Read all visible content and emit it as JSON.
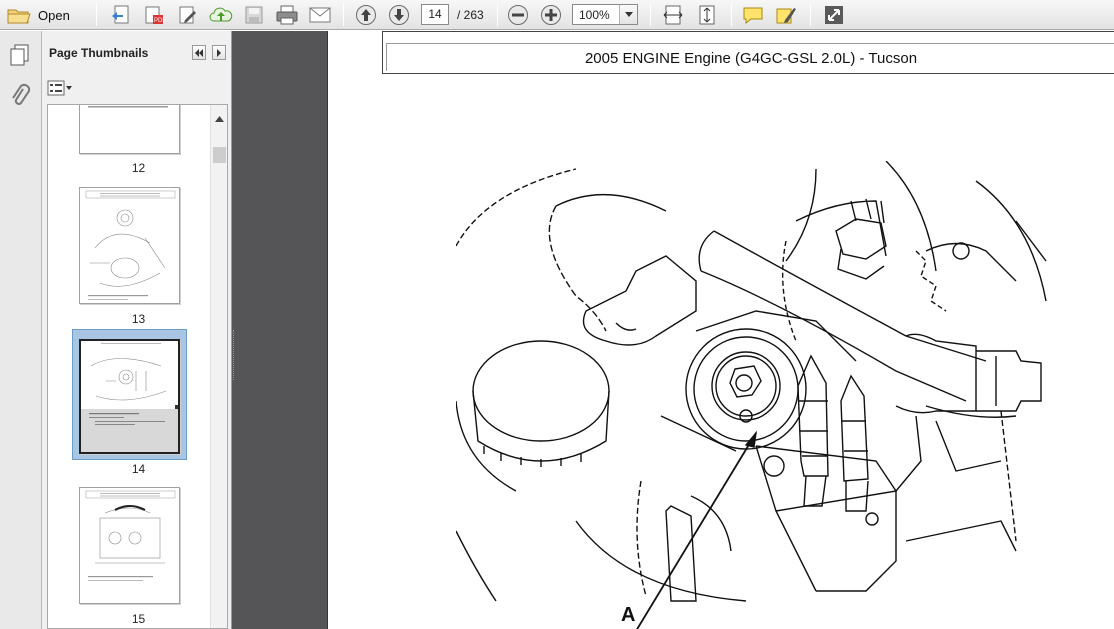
{
  "toolbar": {
    "open_label": "Open",
    "current_page": "14",
    "total_pages": "/ 263",
    "zoom": "100%"
  },
  "sidebar": {
    "title": "Page Thumbnails",
    "thumbnails": [
      {
        "page": "12"
      },
      {
        "page": "13"
      },
      {
        "page": "14",
        "selected": true
      },
      {
        "page": "15"
      }
    ]
  },
  "document": {
    "header": "2005 ENGINE Engine (G4GC-GSL 2.0L) - Tucson",
    "callout": "A"
  },
  "colors": {
    "gutter": "#555557",
    "selection": "#a8c6e3",
    "toolbar": "#e9e9e9"
  }
}
